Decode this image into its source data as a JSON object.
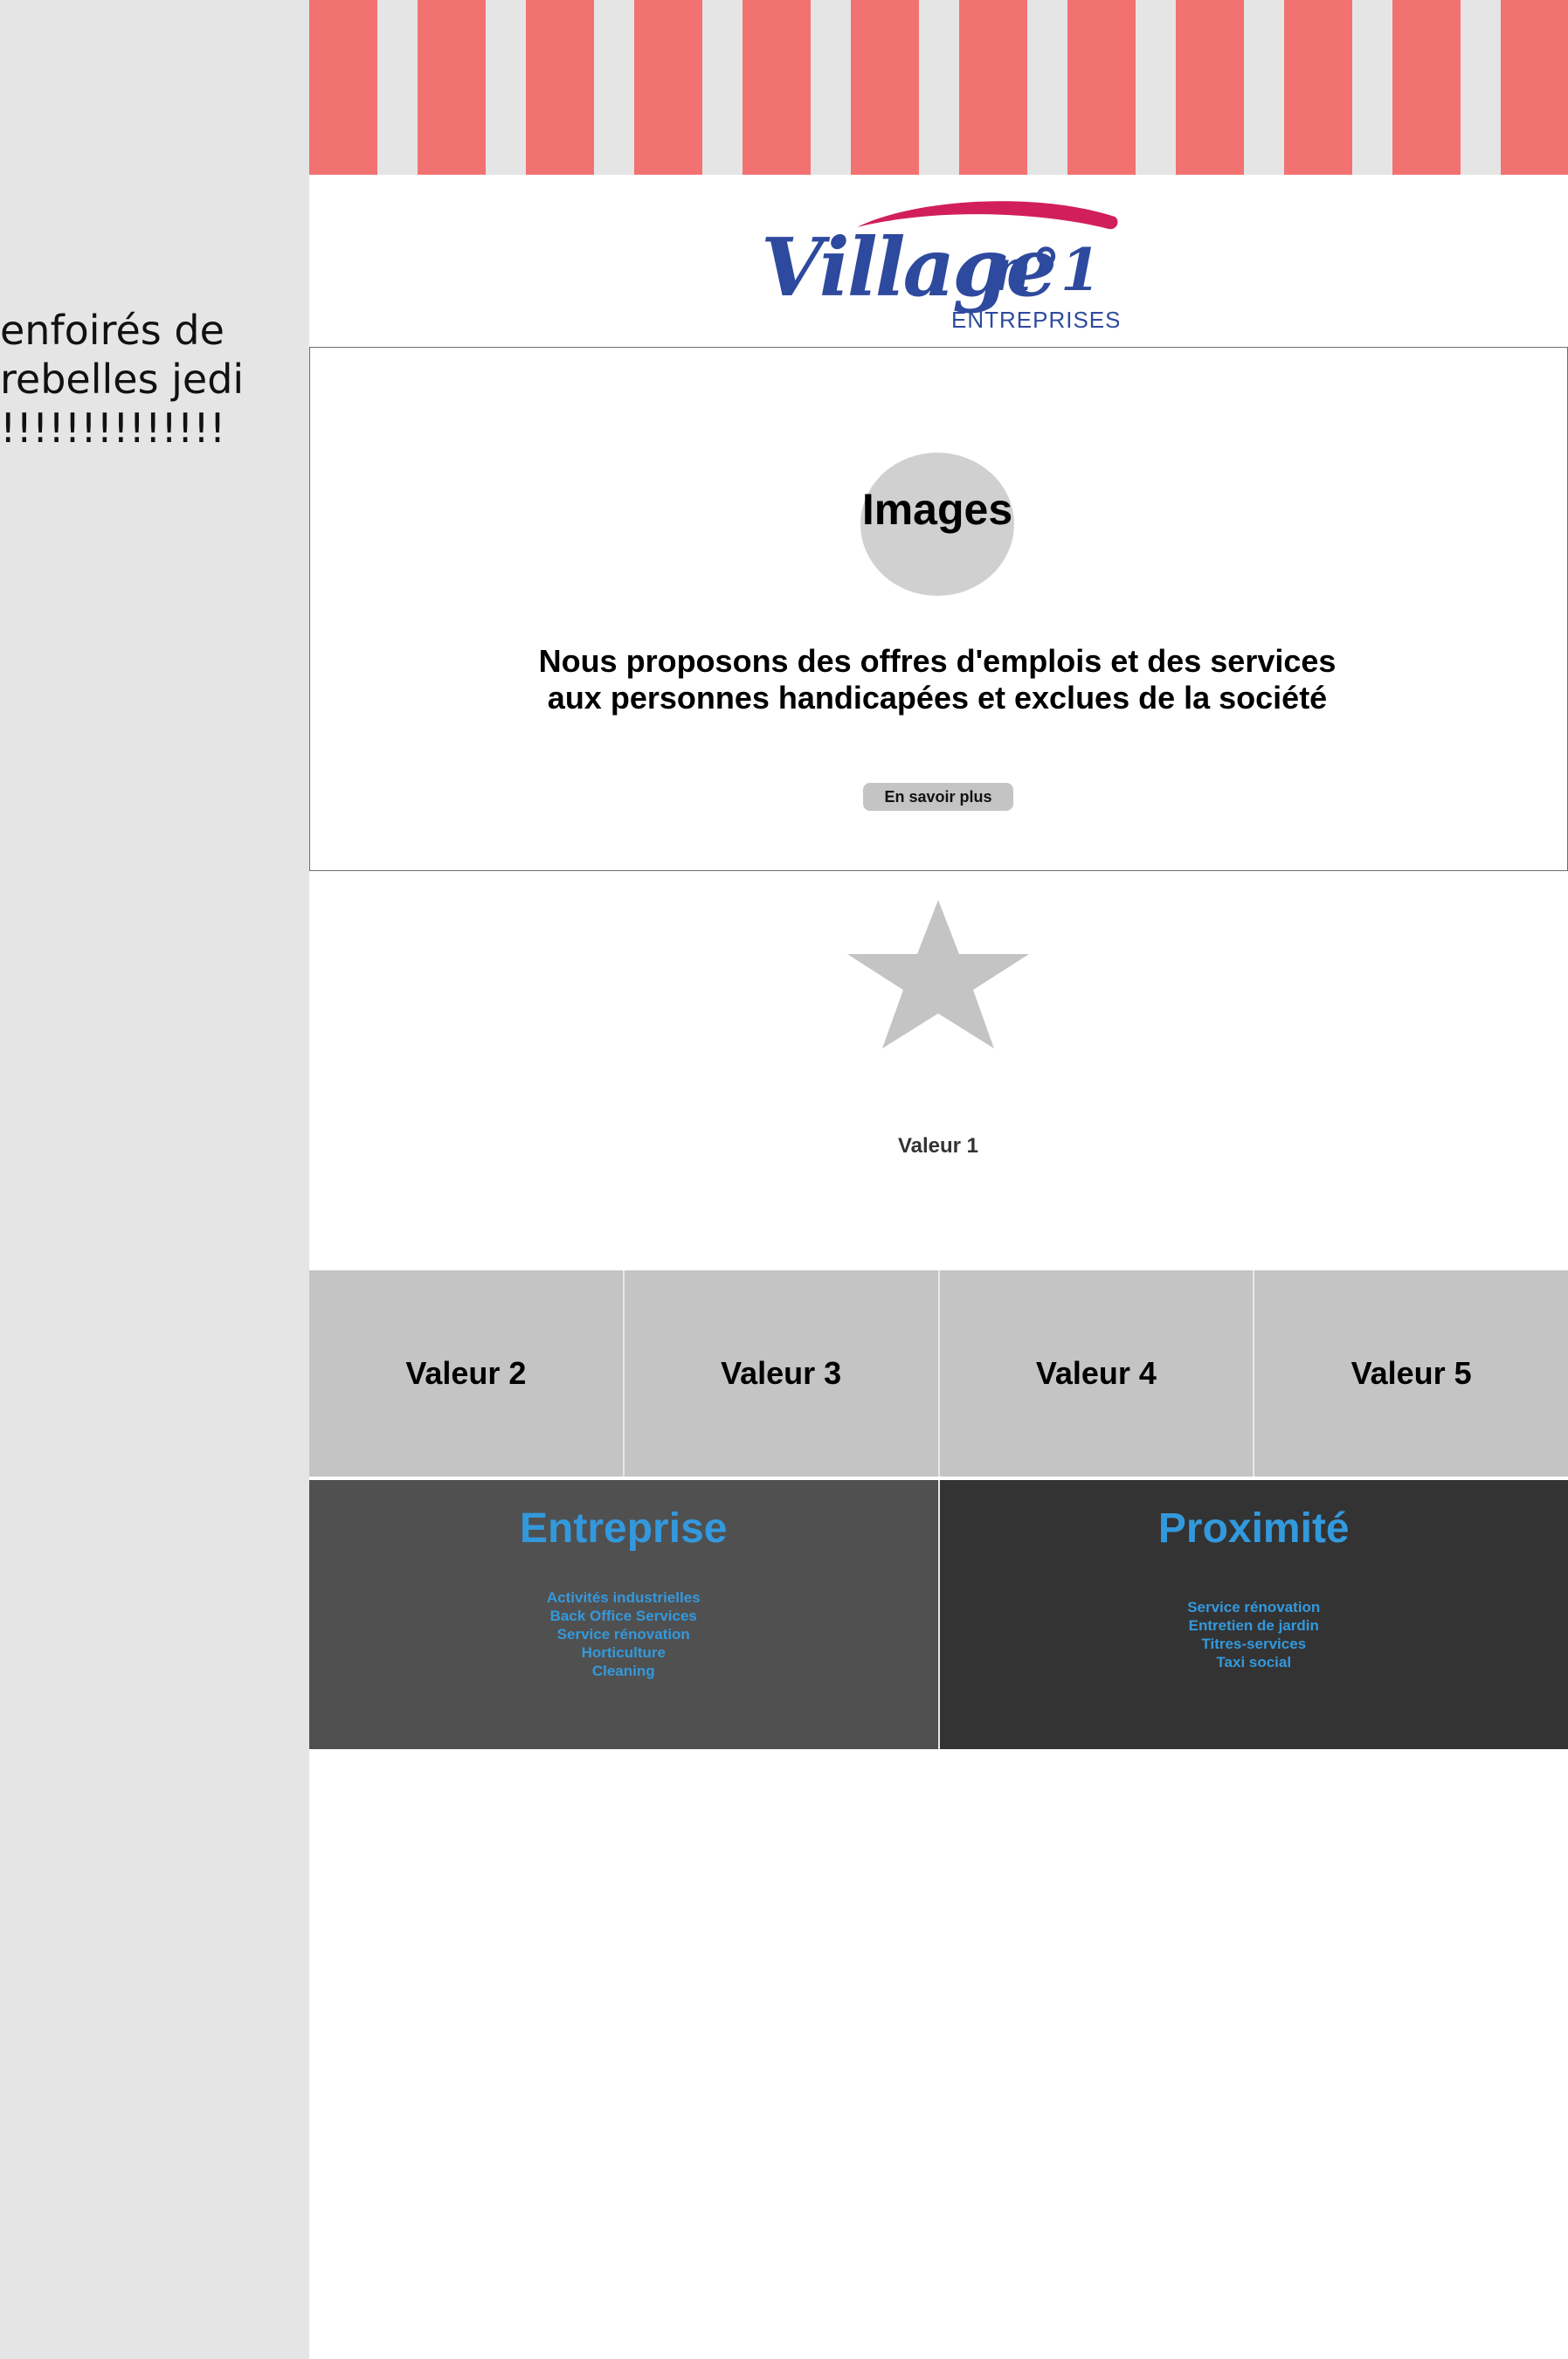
{
  "sidebar": {
    "text": "enfoirés de rebelles jedi !!!!!!!!!!!!!!"
  },
  "logo": {
    "word": "Village",
    "suffix": "n°1",
    "subtitle": "ENTREPRISES",
    "colors": {
      "primary": "#2e4a9e",
      "swoosh": "#d11f5c"
    }
  },
  "hero": {
    "images_label": "Images",
    "tagline": "Nous proposons des offres d'emplois et des services aux personnes handicapées et exclues de la société",
    "button_label": "En savoir plus"
  },
  "values": {
    "featured_icon": "star-icon",
    "featured_label": "Valeur 1",
    "cards": [
      {
        "label": "Valeur 2"
      },
      {
        "label": "Valeur 3"
      },
      {
        "label": "Valeur 4"
      },
      {
        "label": "Valeur 5"
      }
    ]
  },
  "panels": {
    "entreprise": {
      "title": "Entreprise",
      "items": [
        "Activités industrielles",
        "Back Office Services",
        "Service rénovation",
        "Horticulture",
        "Cleaning"
      ]
    },
    "proximite": {
      "title": "Proximité",
      "items": [
        "Service rénovation",
        "Entretien de jardin",
        "Titres-services",
        "Taxi social"
      ]
    }
  },
  "colors": {
    "awning_red": "#f27272",
    "awning_grey": "#e5e5e5",
    "accent_blue": "#3399dd",
    "card_grey": "#c4c4c4",
    "panel_dark": "#505050",
    "panel_darker": "#333333"
  }
}
